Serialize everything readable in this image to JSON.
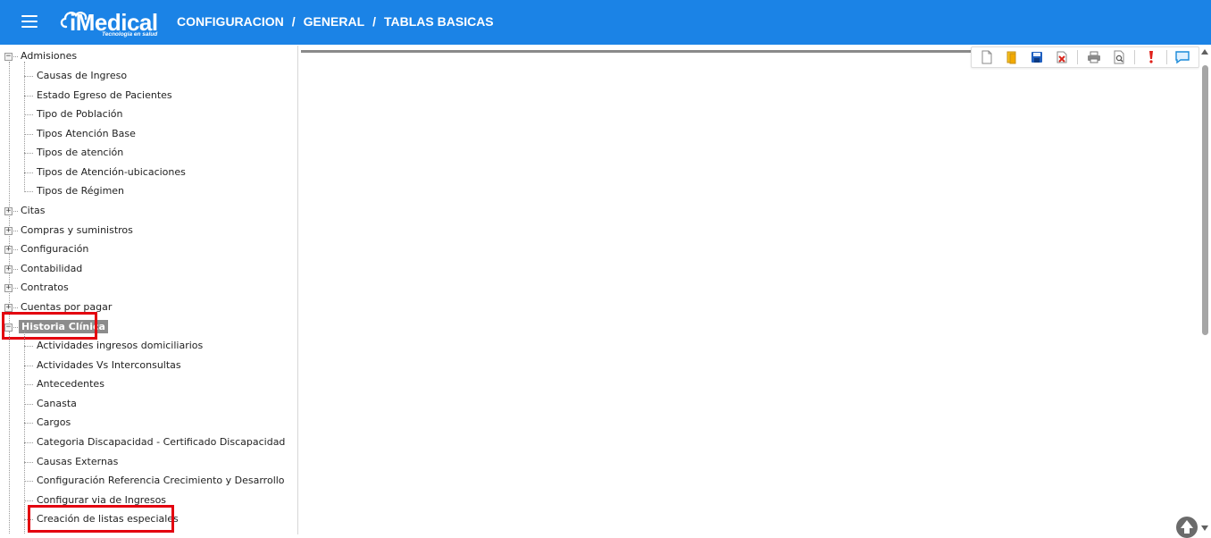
{
  "header": {
    "menu_icon": "hamburger-icon",
    "logo_text": "iMedical",
    "logo_tagline": "Tecnología en salud",
    "breadcrumb": [
      "CONFIGURACION",
      "GENERAL",
      "TABLAS BASICAS"
    ],
    "separator": "/",
    "background": "#1b83e6"
  },
  "tree": {
    "admisiones": {
      "label": "Admisiones",
      "children": [
        "Causas de Ingreso",
        "Estado Egreso de Pacientes",
        "Tipo de Población",
        "Tipos Atención Base",
        "Tipos de atención",
        "Tipos de Atención-ubicaciones",
        "Tipos de Régimen"
      ]
    },
    "collapsed": [
      "Citas",
      "Compras y suministros",
      "Configuración",
      "Contabilidad",
      "Contratos",
      "Cuentas por pagar"
    ],
    "historia": {
      "label": "Historia Clínica",
      "children": [
        "Actividades ingresos domiciliarios",
        "Actividades Vs Interconsultas",
        "Antecedentes",
        "Canasta",
        "Cargos",
        "Categoria Discapacidad - Certificado Discapacidad",
        "Causas Externas",
        "Configuración Referencia Crecimiento y Desarrollo",
        "Configurar via de Ingresos",
        "Creación de listas especiales"
      ]
    }
  },
  "toolbar": {
    "buttons": [
      {
        "name": "new-document-icon",
        "title": "Nuevo"
      },
      {
        "name": "open-folder-icon",
        "title": "Abrir"
      },
      {
        "name": "save-icon",
        "title": "Guardar"
      },
      {
        "name": "delete-icon",
        "title": "Eliminar"
      },
      {
        "name": "print-icon",
        "title": "Imprimir"
      },
      {
        "name": "preview-icon",
        "title": "Vista previa"
      },
      {
        "name": "alert-icon",
        "title": "Alerta"
      },
      {
        "name": "comment-icon",
        "title": "Comentario"
      }
    ]
  },
  "colors": {
    "highlight_box": "#e3000f",
    "selected_node_bg": "#8c8c8c"
  }
}
